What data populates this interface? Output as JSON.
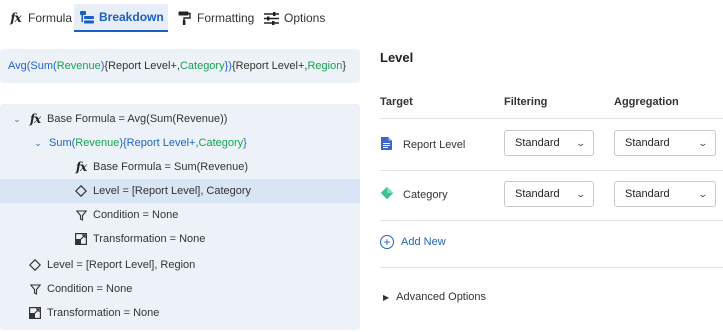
{
  "tabs": [
    {
      "label": "Formula",
      "icon": "fx-icon"
    },
    {
      "label": "Breakdown",
      "icon": "breakdown-icon",
      "active": true
    },
    {
      "label": "Formatting",
      "icon": "paint-roller-icon"
    },
    {
      "label": "Options",
      "icon": "sliders-icon"
    }
  ],
  "fx_glyph": "fx",
  "formula": {
    "avg": "Avg(",
    "sum": "Sum(",
    "revenue": "Revenue",
    "p1": ")",
    "brace_open": "{Report Level+,",
    "category": "Category",
    "brace_close1": "})",
    "brace_open2": "{Report Level+,",
    "region": "Region",
    "brace_close2": "}"
  },
  "tree": {
    "base_formula": "Base Formula = Avg(Sum(Revenue))",
    "sum_node": {
      "sum": "Sum(",
      "revenue": "Revenue",
      "mid": "){Report Level+,",
      "category": "Category",
      "end": "}"
    },
    "child_base_formula": "Base Formula = Sum(Revenue)",
    "child_level": "Level = [Report Level], Category",
    "child_condition": "Condition = None",
    "child_transformation": "Transformation = None",
    "level": "Level = [Report Level], Region",
    "condition": "Condition = None",
    "transformation": "Transformation = None"
  },
  "panel": {
    "title": "Level",
    "col_target": "Target",
    "col_filtering": "Filtering",
    "col_aggregation": "Aggregation",
    "rows": [
      {
        "target": "Report Level",
        "icon": "document-icon",
        "filtering": "Standard",
        "aggregation": "Standard"
      },
      {
        "target": "Category",
        "icon": "diamond-icon",
        "filtering": "Standard",
        "aggregation": "Standard"
      }
    ],
    "add_new": "Add New",
    "advanced": "Advanced Options"
  },
  "colors": {
    "accent": "#1f63c4",
    "green": "#17a253",
    "panel_bg": "#edf2f9",
    "selected_row": "#d9e4f4",
    "diamond": "#3dbf9a"
  }
}
